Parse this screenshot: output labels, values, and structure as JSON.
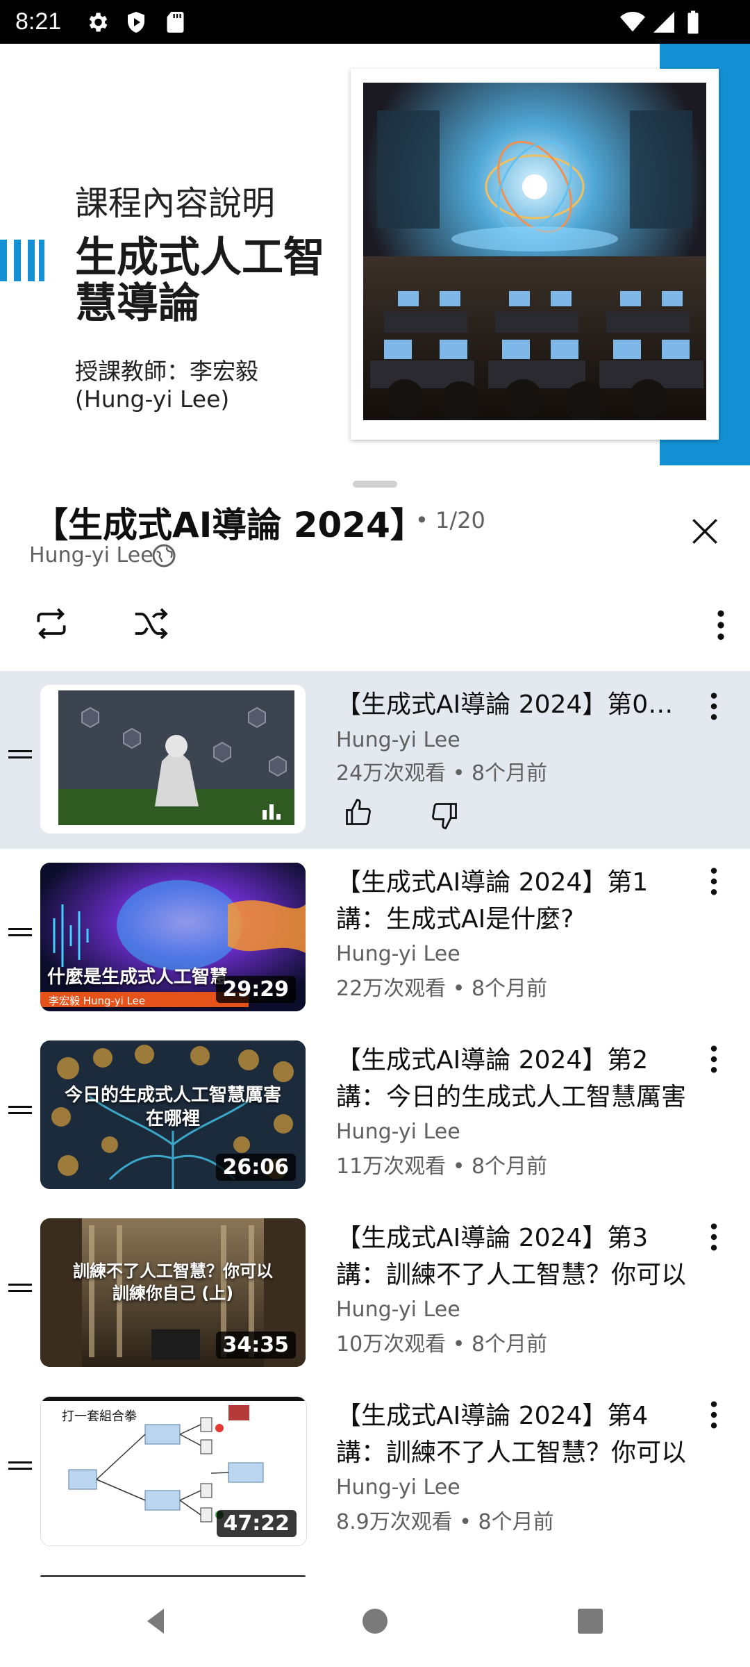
{
  "status": {
    "time": "8:21"
  },
  "slide": {
    "small_title": "課程內容說明",
    "big_title": "生成式人工智慧導論",
    "teacher_line1": "授課教師：李宏毅",
    "teacher_line2": "(Hung-yi Lee)"
  },
  "playlist": {
    "title": "【生成式AI導論 2024】",
    "count": "• 1/20",
    "channel": "Hung-yi Lee"
  },
  "items": [
    {
      "title": "【生成式AI導論 2024】第0講…",
      "channel": "Hung-yi Lee",
      "meta": "24万次观看 • 8个月前",
      "duration": ""
    },
    {
      "title": "【生成式AI導論 2024】第1講：生成式AI是什麼?",
      "channel": "Hung-yi Lee",
      "meta": "22万次观看 • 8个月前",
      "duration": "29:29",
      "thumb_text": "什麼是生成式人工智慧",
      "thumb_sub": "李宏毅 Hung-yi Lee"
    },
    {
      "title": "【生成式AI導論 2024】第2講：今日的生成式人工智慧厲害在…",
      "channel": "Hung-yi Lee",
      "meta": "11万次观看 • 8个月前",
      "duration": "26:06",
      "thumb_text": "今日的生成式人工智慧厲害在哪裡"
    },
    {
      "title": "【生成式AI導論 2024】第3講：訓練不了人工智慧？你可以訓…",
      "channel": "Hung-yi Lee",
      "meta": "10万次观看 • 8个月前",
      "duration": "34:35",
      "thumb_text": "訓練不了人工智慧？你可以訓練你自己 (上)"
    },
    {
      "title": "【生成式AI導論 2024】第4講：訓練不了人工智慧？你可以訓…",
      "channel": "Hung-yi Lee",
      "meta": "8.9万次观看 • 8个月前",
      "duration": "47:22",
      "thumb_text": "打一套組合拳"
    }
  ],
  "colors": {
    "accent_blue": "#1390d3",
    "active_row": "#e4e8ef"
  }
}
